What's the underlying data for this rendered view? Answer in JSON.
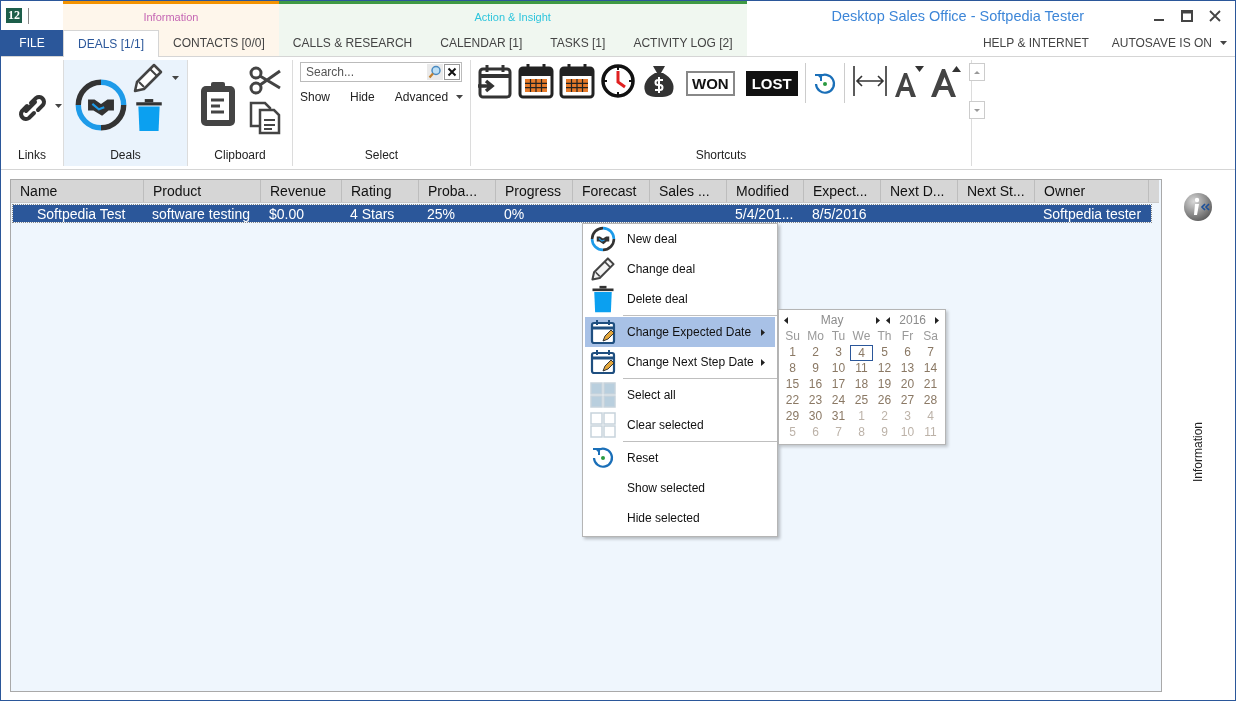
{
  "app": {
    "logo": "12"
  },
  "window": {
    "title": "Desktop Sales Office - Softpedia Tester"
  },
  "file_tab": "FILE",
  "tab_groups": [
    {
      "label": "Information",
      "color": "#f39200",
      "tabs": [
        {
          "label": "DEALS [1/1]",
          "selected": true
        },
        {
          "label": "CONTACTS [0/0]",
          "selected": false
        }
      ]
    },
    {
      "label": "Action & Insight",
      "color": "#3f9a44",
      "tabs": [
        {
          "label": "CALLS & RESEARCH",
          "selected": false
        },
        {
          "label": "CALENDAR [1]",
          "selected": false
        },
        {
          "label": "TASKS [1]",
          "selected": false
        },
        {
          "label": "ACTIVITY LOG [2]",
          "selected": false
        }
      ]
    }
  ],
  "right_links": [
    "HELP & INTERNET",
    "AUTOSAVE IS ON"
  ],
  "ribbon": {
    "groups": [
      {
        "label": "Links",
        "selected": false
      },
      {
        "label": "Deals",
        "selected": true
      },
      {
        "label": "Clipboard",
        "selected": false
      },
      {
        "label": "Select",
        "selected": false
      },
      {
        "label": "Shortcuts",
        "selected": false
      }
    ]
  },
  "search": {
    "placeholder": "Search..."
  },
  "select_buttons": [
    "Show",
    "Hide",
    "Advanced"
  ],
  "shortcut_badges": [
    {
      "label": "WON",
      "kind": "outline"
    },
    {
      "label": "LOST",
      "kind": "solid"
    }
  ],
  "table": {
    "columns": [
      "Name",
      "Product",
      "Revenue",
      "Rating",
      "Proba...",
      "Progress",
      "Forecast",
      "Sales ...",
      "Modified",
      "Expect...",
      "Next D...",
      "Next St...",
      "Owner"
    ],
    "rows": [
      {
        "selected": true,
        "cells": [
          "Softpedia Test",
          "software testing",
          "$0.00",
          "4 Stars",
          "25%",
          "0%",
          "",
          "",
          "5/4/201...",
          "8/5/2016",
          "",
          "",
          "Softpedia tester"
        ]
      }
    ]
  },
  "context_menu": {
    "items": [
      {
        "kind": "item",
        "label": "New deal",
        "submenu": false,
        "selected": false
      },
      {
        "kind": "item",
        "label": "Change deal",
        "submenu": false,
        "selected": false
      },
      {
        "kind": "item",
        "label": "Delete deal",
        "submenu": false,
        "selected": false
      },
      {
        "kind": "separator"
      },
      {
        "kind": "item",
        "label": "Change Expected Date",
        "submenu": true,
        "selected": true
      },
      {
        "kind": "item",
        "label": "Change Next Step Date",
        "submenu": true,
        "selected": false
      },
      {
        "kind": "separator"
      },
      {
        "kind": "item",
        "label": "Select all",
        "submenu": false,
        "selected": false
      },
      {
        "kind": "item",
        "label": "Clear selected",
        "submenu": false,
        "selected": false
      },
      {
        "kind": "separator"
      },
      {
        "kind": "item",
        "label": "Reset",
        "submenu": false,
        "selected": false
      },
      {
        "kind": "item",
        "label": "Show selected",
        "submenu": false,
        "selected": false
      },
      {
        "kind": "item",
        "label": "Hide selected",
        "submenu": false,
        "selected": false
      }
    ]
  },
  "calendar": {
    "month": "May",
    "year": "2016",
    "weekdays": [
      "Su",
      "Mo",
      "Tu",
      "We",
      "Th",
      "Fr",
      "Sa"
    ],
    "weeks": [
      [
        {
          "day": "1",
          "other_month": false,
          "selected": false
        },
        {
          "day": "2",
          "other_month": false,
          "selected": false
        },
        {
          "day": "3",
          "other_month": false,
          "selected": false
        },
        {
          "day": "4",
          "other_month": false,
          "selected": true
        },
        {
          "day": "5",
          "other_month": false,
          "selected": false
        },
        {
          "day": "6",
          "other_month": false,
          "selected": false
        },
        {
          "day": "7",
          "other_month": false,
          "selected": false
        }
      ],
      [
        {
          "day": "8",
          "other_month": false,
          "selected": false
        },
        {
          "day": "9",
          "other_month": false,
          "selected": false
        },
        {
          "day": "10",
          "other_month": false,
          "selected": false
        },
        {
          "day": "11",
          "other_month": false,
          "selected": false
        },
        {
          "day": "12",
          "other_month": false,
          "selected": false
        },
        {
          "day": "13",
          "other_month": false,
          "selected": false
        },
        {
          "day": "14",
          "other_month": false,
          "selected": false
        }
      ],
      [
        {
          "day": "15",
          "other_month": false,
          "selected": false
        },
        {
          "day": "16",
          "other_month": false,
          "selected": false
        },
        {
          "day": "17",
          "other_month": false,
          "selected": false
        },
        {
          "day": "18",
          "other_month": false,
          "selected": false
        },
        {
          "day": "19",
          "other_month": false,
          "selected": false
        },
        {
          "day": "20",
          "other_month": false,
          "selected": false
        },
        {
          "day": "21",
          "other_month": false,
          "selected": false
        }
      ],
      [
        {
          "day": "22",
          "other_month": false,
          "selected": false
        },
        {
          "day": "23",
          "other_month": false,
          "selected": false
        },
        {
          "day": "24",
          "other_month": false,
          "selected": false
        },
        {
          "day": "25",
          "other_month": false,
          "selected": false
        },
        {
          "day": "26",
          "other_month": false,
          "selected": false
        },
        {
          "day": "27",
          "other_month": false,
          "selected": false
        },
        {
          "day": "28",
          "other_month": false,
          "selected": false
        }
      ],
      [
        {
          "day": "29",
          "other_month": false,
          "selected": false
        },
        {
          "day": "30",
          "other_month": false,
          "selected": false
        },
        {
          "day": "31",
          "other_month": false,
          "selected": false
        },
        {
          "day": "1",
          "other_month": true,
          "selected": false
        },
        {
          "day": "2",
          "other_month": true,
          "selected": false
        },
        {
          "day": "3",
          "other_month": true,
          "selected": false
        },
        {
          "day": "4",
          "other_month": true,
          "selected": false
        }
      ],
      [
        {
          "day": "5",
          "other_month": true,
          "selected": false
        },
        {
          "day": "6",
          "other_month": true,
          "selected": false
        },
        {
          "day": "7",
          "other_month": true,
          "selected": false
        },
        {
          "day": "8",
          "other_month": true,
          "selected": false
        },
        {
          "day": "9",
          "other_month": true,
          "selected": false
        },
        {
          "day": "10",
          "other_month": true,
          "selected": false
        },
        {
          "day": "11",
          "other_month": true,
          "selected": false
        }
      ]
    ]
  },
  "side_panel": {
    "label": "Information"
  }
}
